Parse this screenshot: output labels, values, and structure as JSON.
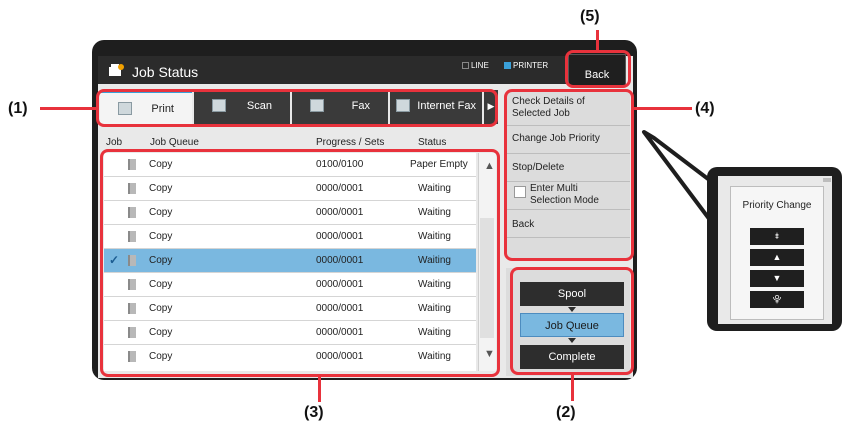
{
  "header": {
    "title": "Job Status",
    "status_line": "LINE",
    "status_printer": "PRINTER",
    "back_label": "Back"
  },
  "tabs": [
    {
      "label": "Print",
      "active": true
    },
    {
      "label": "Scan"
    },
    {
      "label": "Fax"
    },
    {
      "label": "Internet Fax"
    }
  ],
  "columns": {
    "job": "Job",
    "queue": "Job Queue",
    "progress": "Progress / Sets",
    "status": "Status"
  },
  "jobs": [
    {
      "name": "Copy",
      "progress": "0100/0100",
      "status": "Paper Empty"
    },
    {
      "name": "Copy",
      "progress": "0000/0001",
      "status": "Waiting"
    },
    {
      "name": "Copy",
      "progress": "0000/0001",
      "status": "Waiting"
    },
    {
      "name": "Copy",
      "progress": "0000/0001",
      "status": "Waiting"
    },
    {
      "name": "Copy",
      "progress": "0000/0001",
      "status": "Waiting",
      "selected": true
    },
    {
      "name": "Copy",
      "progress": "0000/0001",
      "status": "Waiting"
    },
    {
      "name": "Copy",
      "progress": "0000/0001",
      "status": "Waiting"
    },
    {
      "name": "Copy",
      "progress": "0000/0001",
      "status": "Waiting"
    },
    {
      "name": "Copy",
      "progress": "0000/0001",
      "status": "Waiting"
    }
  ],
  "menu": {
    "check_details_1": "Check Details of",
    "check_details_2": "Selected Job",
    "change_priority": "Change Job Priority",
    "stop_delete": "Stop/Delete",
    "multi_1": "Enter Multi",
    "multi_2": "Selection Mode",
    "back": "Back"
  },
  "modes": {
    "spool": "Spool",
    "job_queue": "Job Queue",
    "complete": "Complete"
  },
  "popup": {
    "title": "Priority Change",
    "btn_top": "⯒",
    "btn_up": "▲",
    "btn_down": "▼",
    "btn_bottom": "⯓"
  },
  "callouts": {
    "c1": "(1)",
    "c2": "(2)",
    "c3": "(3)",
    "c4": "(4)",
    "c5": "(5)"
  },
  "colors": {
    "accent": "#e8323c",
    "selected": "#7ab8e0",
    "line_square": "#2b2b2b",
    "printer_square": "#3aa0d8"
  }
}
